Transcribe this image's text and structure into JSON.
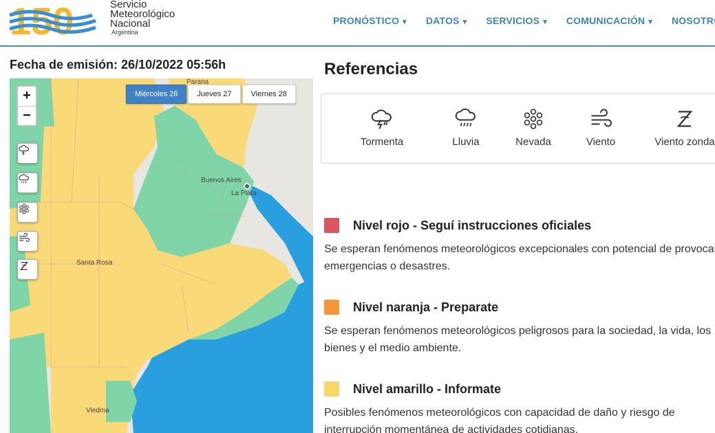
{
  "header": {
    "logo_number": "150",
    "logo_lines": [
      "Servicio",
      "Meteorológico",
      "Nacional"
    ],
    "logo_country": "Argentina",
    "nav": [
      {
        "label": "PRONÓSTICO"
      },
      {
        "label": "DATOS"
      },
      {
        "label": "SERVICIOS"
      },
      {
        "label": "COMUNICACIÓN"
      },
      {
        "label": "NOSOTROS"
      }
    ]
  },
  "emission": "Fecha de emisión: 26/10/2022 05:56h",
  "map": {
    "tabs": [
      "Miércoles 26",
      "Jueves 27",
      "Viernes 28"
    ],
    "active_tab": "Miércoles 26",
    "zoom_in": "+",
    "zoom_out": "−",
    "hazard_buttons": [
      "storm-icon",
      "rain-icon",
      "snow-icon",
      "wind-icon",
      "zonda-icon"
    ],
    "cities": {
      "buenos_aires": "Buenos Aires",
      "la_plata": "La Plata",
      "santa_rosa": "Santa Rosa",
      "viedma": "Viedma",
      "parana": "Parana"
    },
    "colors": {
      "green": "#7fd4a8",
      "yellow": "#f9d978",
      "sea": "#2a9fdf",
      "land": "#e8e6e0"
    }
  },
  "references": {
    "title": "Referencias",
    "items": [
      {
        "label": "Tormenta",
        "icon": "storm-icon"
      },
      {
        "label": "Lluvia",
        "icon": "rain-icon"
      },
      {
        "label": "Nevada",
        "icon": "snow-icon"
      },
      {
        "label": "Viento",
        "icon": "wind-icon"
      },
      {
        "label": "Viento zonda",
        "icon": "zonda-icon"
      }
    ]
  },
  "levels": [
    {
      "color": "#dc5563",
      "title": "Nivel rojo - Seguí instrucciones oficiales",
      "desc": "Se esperan fenómenos meteorológicos excepcionales con potencial de provocar emergencias o desastres."
    },
    {
      "color": "#f6963b",
      "title": "Nivel naranja - Preparate",
      "desc": "Se esperan fenómenos meteorológicos peligrosos para la sociedad, la vida, los bienes y el medio ambiente."
    },
    {
      "color": "#fad666",
      "title": "Nivel amarillo - Informate",
      "desc": "Posibles fenómenos meteorológicos con capacidad de daño y riesgo de interrupción momentánea de actividades cotidianas."
    }
  ]
}
